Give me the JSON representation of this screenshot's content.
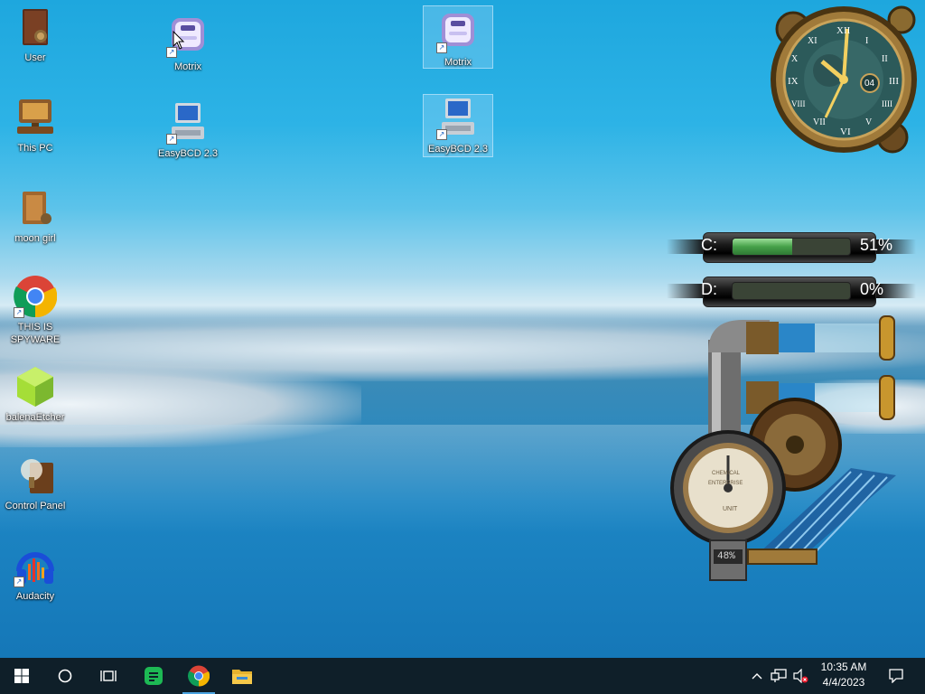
{
  "desktop": {
    "icons": [
      {
        "label": "User",
        "icon": "folder-user-icon"
      },
      {
        "label": "This PC",
        "icon": "computer-icon"
      },
      {
        "label": "moon girl",
        "icon": "folder-icon"
      },
      {
        "label": "THIS IS SPYWARE",
        "icon": "chrome-icon"
      },
      {
        "label": "balenaEtcher",
        "icon": "balena-etcher-icon"
      },
      {
        "label": "Control Panel",
        "icon": "control-panel-icon"
      },
      {
        "label": "Audacity",
        "icon": "audacity-icon"
      },
      {
        "label": "Motrix",
        "icon": "motrix-icon"
      },
      {
        "label": "EasyBCD 2.3",
        "icon": "easybcd-icon"
      },
      {
        "label": "Motrix",
        "icon": "motrix-icon"
      },
      {
        "label": "EasyBCD 2.3",
        "icon": "easybcd-icon"
      }
    ]
  },
  "widgets": {
    "clock": {
      "numerals": [
        "XII",
        "I",
        "II",
        "III",
        "IIII",
        "V",
        "VI",
        "VII",
        "VIII",
        "IX",
        "X",
        "XI"
      ],
      "date": "04"
    },
    "drives": [
      {
        "letter": "C:",
        "percent_text": "51%",
        "fill": 0.51
      },
      {
        "letter": "D:",
        "percent_text": "0%",
        "fill": 0.0
      }
    ],
    "cpu_meter": {
      "dial_text_1": "CHEMICAL",
      "dial_text_2": "ENTERPRISE",
      "dial_text_3": "UNIT",
      "readout": "48%"
    }
  },
  "taskbar": {
    "buttons": [
      "start-icon",
      "search-icon",
      "task-view-icon",
      "notes-app-icon",
      "chrome-icon",
      "file-explorer-icon"
    ],
    "clock_time": "10:35 AM",
    "clock_date": "4/4/2023",
    "colors": {
      "background": "#0f1f29",
      "active_underline": "#4aa3e0"
    }
  }
}
